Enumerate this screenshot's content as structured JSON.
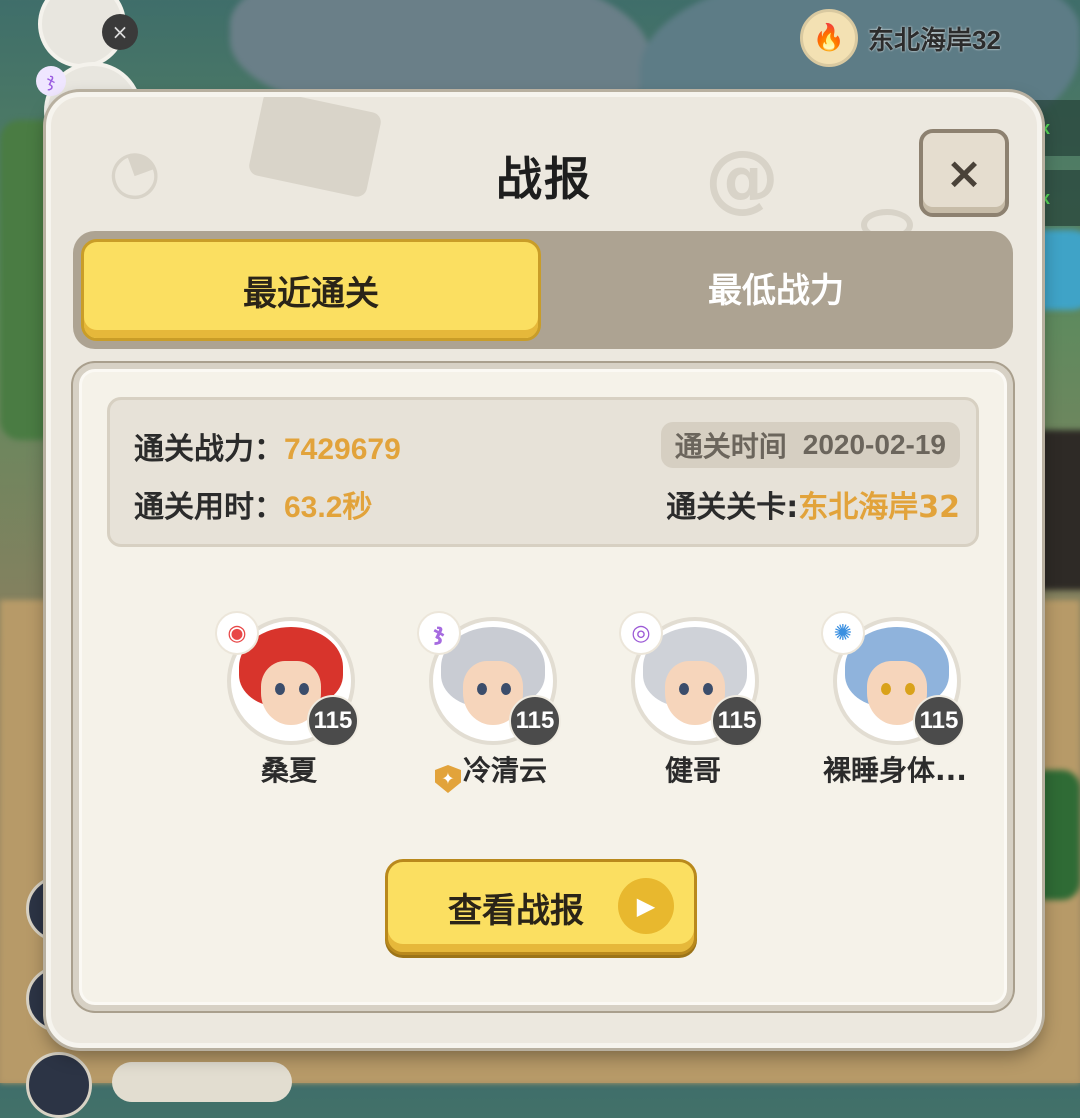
{
  "hud": {
    "location": "东北海岸32",
    "max_labels": [
      "ax",
      "ax"
    ],
    "chat_preview": "..."
  },
  "dialog": {
    "title": "战报",
    "close_label": "×",
    "tabs": [
      {
        "label": "最近通关",
        "active": true
      },
      {
        "label": "最低战力",
        "active": false
      }
    ],
    "stats": {
      "power_label": "通关战力：",
      "power_value": "7429679",
      "duration_label": "通关用时：",
      "duration_value": "63.2秒",
      "time_label": "通关时间",
      "time_value": "2020-02-19",
      "level_label": "通关关卡:",
      "level_value": "东北海岸32"
    },
    "heroes": [
      {
        "name": "桑夏",
        "level": "115",
        "element_icon": "fire-element-icon",
        "element_color": "#e84848",
        "hair_color": "#d8342c"
      },
      {
        "name": "冷清云",
        "level": "115",
        "element_icon": "wind-element-icon",
        "element_color": "#a66be0",
        "hair_color": "#c9ccd3",
        "badge_icon": "shield-badge-icon"
      },
      {
        "name": "健哥",
        "level": "115",
        "element_icon": "dark-element-icon",
        "element_color": "#9c5ad6",
        "hair_color": "#cfd2d8"
      },
      {
        "name": "裸睡身体...",
        "level": "115",
        "element_icon": "water-element-icon",
        "element_color": "#3a8fe0",
        "hair_color": "#8fb3dc"
      }
    ],
    "view_button_label": "查看战报"
  },
  "colors": {
    "accent_yellow": "#fbdf61",
    "value_orange": "#e2a33b",
    "tab_bar": "#ada392",
    "panel_bg": "#f5f2e9"
  }
}
